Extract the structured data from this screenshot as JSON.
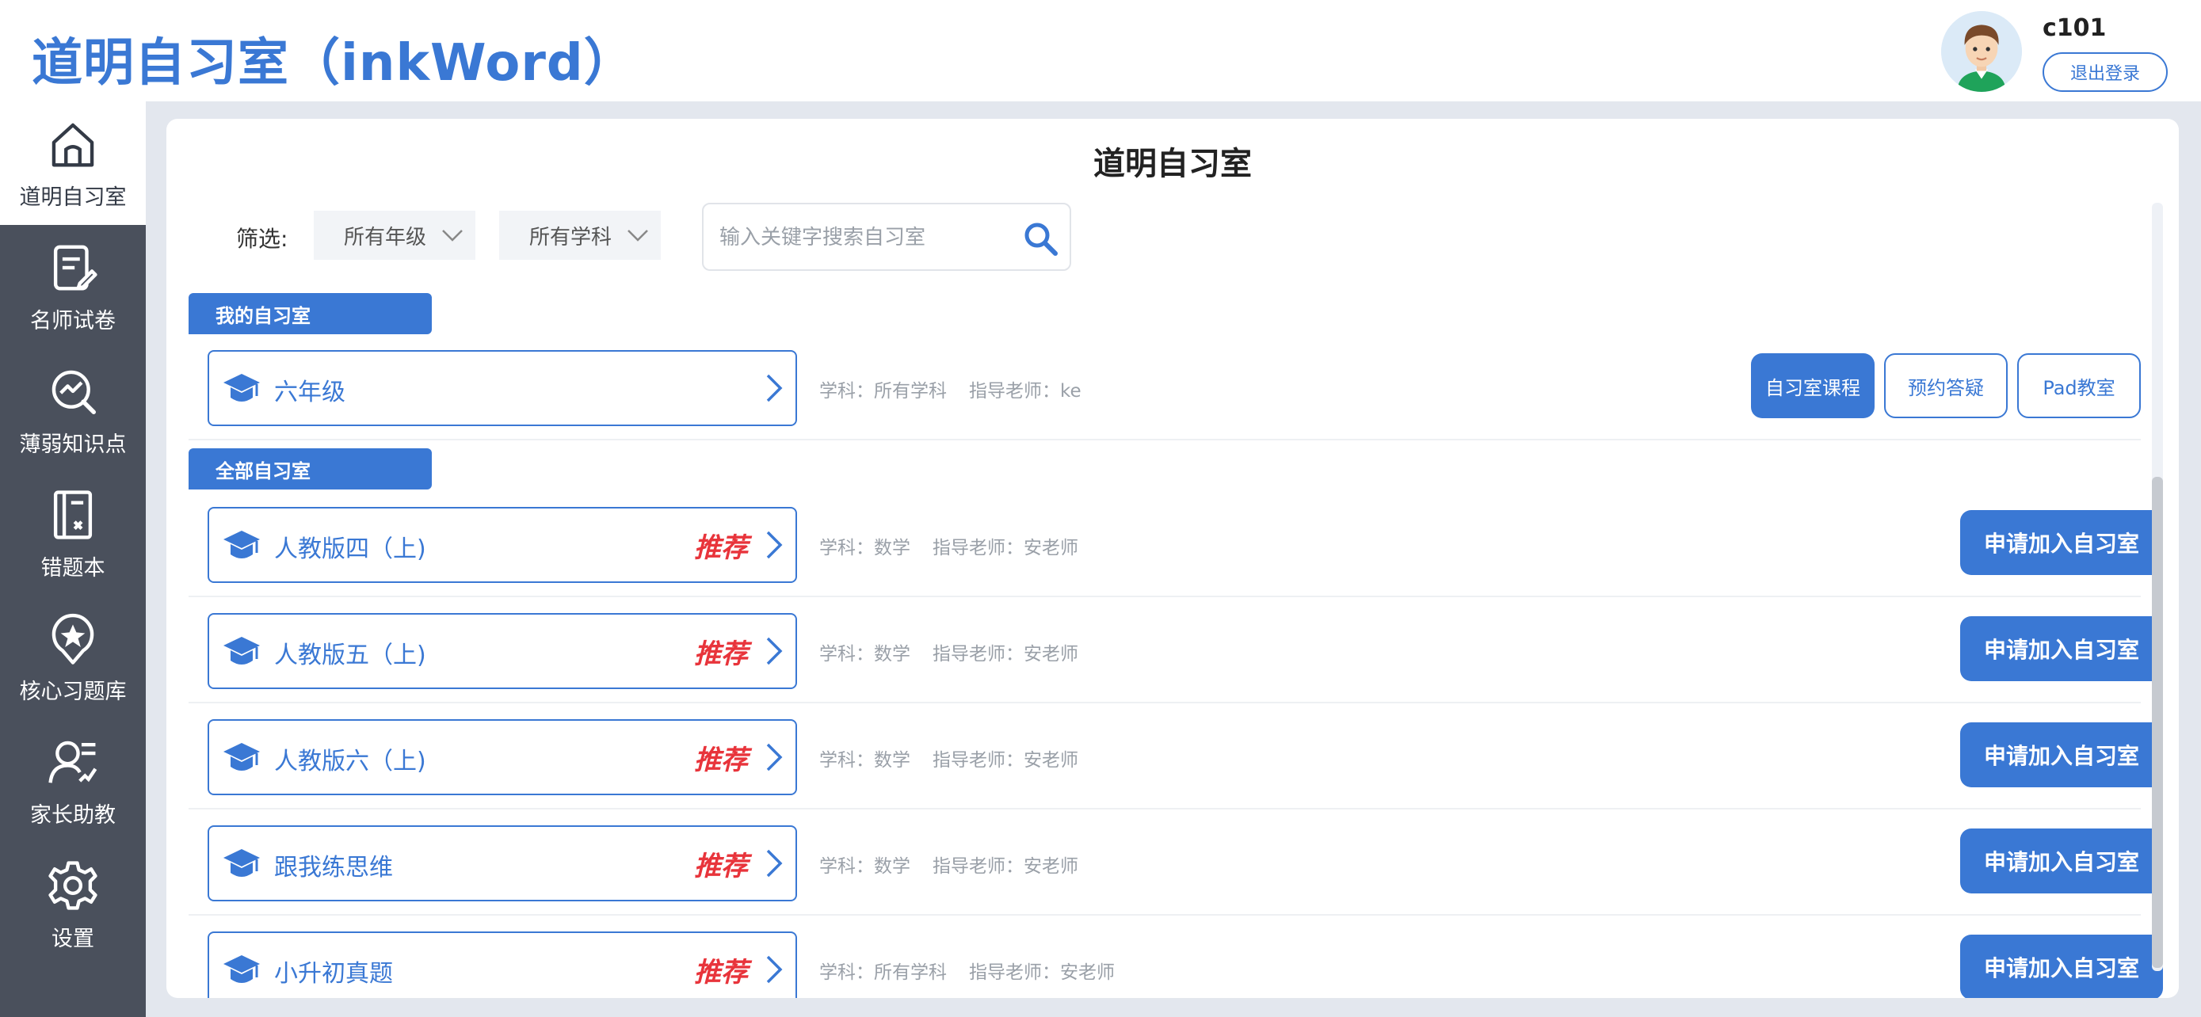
{
  "header": {
    "app_title": "道明自习室（inkWord）",
    "username": "c101",
    "logout_label": "退出登录"
  },
  "sidebar": {
    "items": [
      {
        "label": "道明自习室",
        "icon": "home-icon",
        "active": true
      },
      {
        "label": "名师试卷",
        "icon": "exam-paper-icon",
        "active": false
      },
      {
        "label": "薄弱知识点",
        "icon": "chart-search-icon",
        "active": false
      },
      {
        "label": "错题本",
        "icon": "notebook-icon",
        "active": false
      },
      {
        "label": "核心习题库",
        "icon": "star-pin-icon",
        "active": false
      },
      {
        "label": "家长助教",
        "icon": "parent-icon",
        "active": false
      },
      {
        "label": "设置",
        "icon": "gear-icon",
        "active": false
      }
    ]
  },
  "main": {
    "title": "道明自习室",
    "filter_label": "筛选:",
    "grade_filter": "所有年级",
    "subject_filter": "所有学科",
    "search_placeholder": "输入关键字搜索自习室",
    "my_section": {
      "label": "我的自习室",
      "rooms": [
        {
          "name": "六年级",
          "subject": "学科：所有学科",
          "teacher": "指导老师：ke",
          "actions": [
            "自习室课程",
            "预约答疑",
            "Pad教室"
          ]
        }
      ]
    },
    "all_section": {
      "label": "全部自习室",
      "recommend_label": "推荐",
      "join_label": "申请加入自习室",
      "rooms": [
        {
          "name": "人教版四（上)",
          "subject": "学科：数学",
          "teacher": "指导老师：安老师"
        },
        {
          "name": "人教版五（上)",
          "subject": "学科：数学",
          "teacher": "指导老师：安老师"
        },
        {
          "name": "人教版六（上)",
          "subject": "学科：数学",
          "teacher": "指导老师：安老师"
        },
        {
          "name": "跟我练思维",
          "subject": "学科：数学",
          "teacher": "指导老师：安老师"
        },
        {
          "name": "小升初真题",
          "subject": "学科：所有学科",
          "teacher": "指导老师：安老师"
        }
      ]
    }
  },
  "colors": {
    "accent": "#3a78d4",
    "sidebar": "#4a505c",
    "recommend": "#e8343b"
  }
}
